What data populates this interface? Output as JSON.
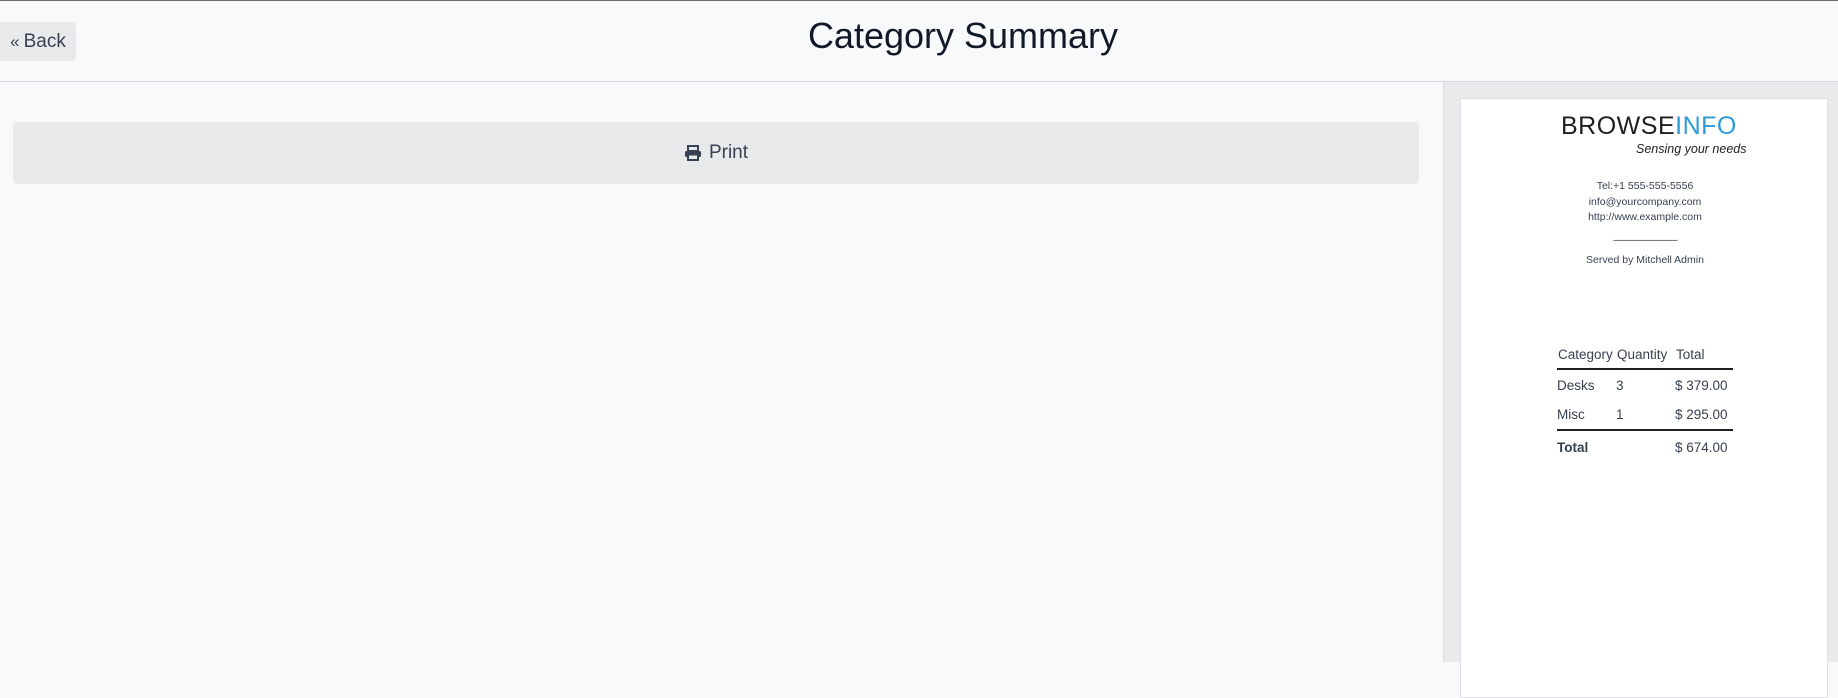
{
  "header": {
    "back_label": "Back",
    "title": "Category Summary"
  },
  "actions": {
    "print_label": "Print"
  },
  "receipt": {
    "logo_primary": "BROWSE",
    "logo_accent": "INFO",
    "logo_tagline": "Sensing your needs",
    "phone": "Tel:+1 555-555-5556",
    "email": "info@yourcompany.com",
    "website": "http://www.example.com",
    "separator": "--------------------------------",
    "served_by": "Served by Mitchell Admin",
    "table": {
      "headers": [
        "Category",
        "Quantity",
        "Total"
      ],
      "rows": [
        {
          "category": "Desks",
          "quantity": "3",
          "total": "$ 379.00"
        },
        {
          "category": "Misc",
          "quantity": "1",
          "total": "$ 295.00"
        }
      ],
      "total_label": "Total",
      "total_value": "$ 674.00"
    }
  },
  "colors": {
    "accent": "#2f9bd6",
    "background": "#f8f9fb",
    "button": "#e8e9eb"
  },
  "icons": {
    "back": "double-chevron-left-icon",
    "print": "printer-icon"
  }
}
